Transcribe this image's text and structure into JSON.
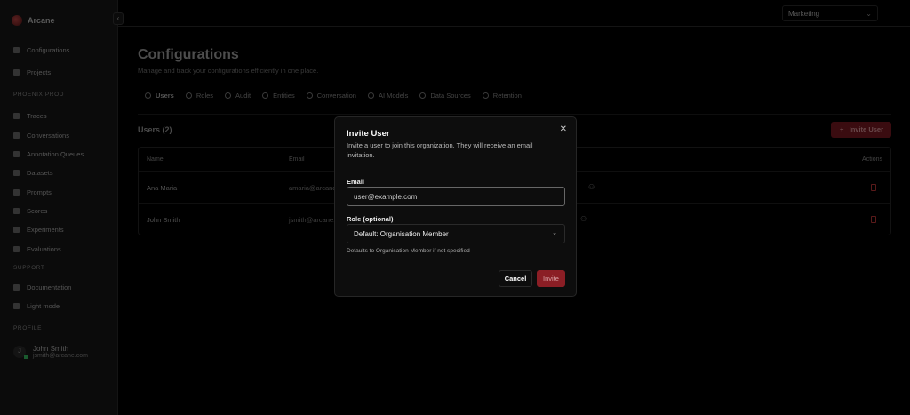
{
  "app": {
    "name": "Arcane"
  },
  "sidebar": {
    "top": [
      {
        "label": "Configurations",
        "icon": "gear-icon"
      },
      {
        "label": "Projects",
        "icon": "folder-icon"
      }
    ],
    "section_project": "PHOENIX PROD",
    "project_items": [
      {
        "label": "Traces",
        "icon": "grid-icon"
      },
      {
        "label": "Conversations",
        "icon": "chat-icon"
      },
      {
        "label": "Annotation Queues",
        "icon": "calendar-edit-icon"
      },
      {
        "label": "Datasets",
        "icon": "database-icon"
      },
      {
        "label": "Prompts",
        "icon": "file-icon"
      },
      {
        "label": "Scores",
        "icon": "lightbulb-icon"
      },
      {
        "label": "Experiments",
        "icon": "flask-icon"
      },
      {
        "label": "Evaluations",
        "icon": "check-square-icon"
      }
    ],
    "section_support": "SUPPORT",
    "support_items": [
      {
        "label": "Documentation",
        "icon": "doc-icon"
      },
      {
        "label": "Light mode",
        "icon": "sun-icon"
      }
    ],
    "section_profile": "PROFILE",
    "profile": {
      "initial": "J",
      "name": "John Smith",
      "email": "jsmith@arcane.com"
    }
  },
  "header": {
    "org_select": "Marketing"
  },
  "page": {
    "title": "Configurations",
    "subtitle": "Manage and track your configurations efficiently in one place.",
    "tabs": [
      "Users",
      "Roles",
      "Audit",
      "Entities",
      "Conversation",
      "AI Models",
      "Data Sources",
      "Retention"
    ],
    "active_tab": "Users",
    "users_heading": "Users (2)",
    "invite_button": "Invite User",
    "table": {
      "columns": [
        "Name",
        "Email",
        "Actions"
      ],
      "rows": [
        {
          "name": "Ana Maria",
          "email": "amaria@arcane.com"
        },
        {
          "name": "John Smith",
          "email": "jsmith@arcane.com"
        }
      ]
    }
  },
  "modal": {
    "title": "Invite User",
    "description": "Invite a user to join this organization. They will receive an email invitation.",
    "email_label": "Email",
    "email_placeholder": "user@example.com",
    "role_label": "Role (optional)",
    "role_value": "Default: Organisation Member",
    "role_help": "Defaults to Organisation Member if not specified",
    "cancel": "Cancel",
    "invite": "Invite"
  },
  "colors": {
    "accent": "#8b1e25",
    "danger": "#dc2626"
  }
}
